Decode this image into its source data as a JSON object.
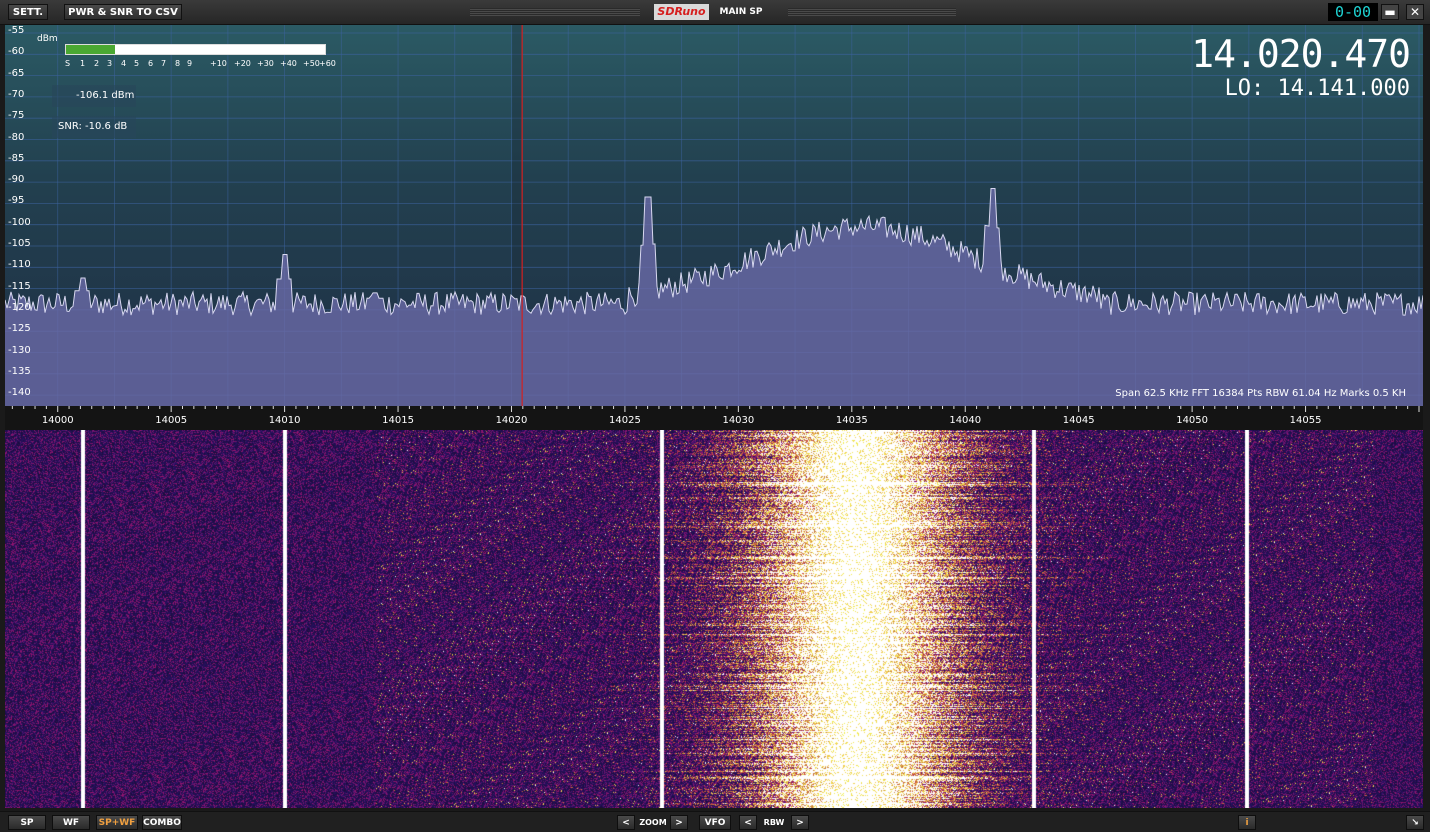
{
  "titlebar": {
    "settings_label": "SETT.",
    "export_label": "PWR & SNR TO CSV",
    "logo_text": "SDRuno",
    "window_name": "MAIN SP",
    "clock": "0-00",
    "minimize": "▬",
    "close": "✕"
  },
  "spectrum": {
    "unit": "dBm",
    "y_labels": [
      "-55",
      "-60",
      "-65",
      "-70",
      "-75",
      "-80",
      "-85",
      "-90",
      "-95",
      "-100",
      "-105",
      "-110",
      "-115",
      "-120",
      "-125",
      "-130",
      "-135",
      "-140"
    ],
    "smeter_labels": [
      "S",
      "1",
      "2",
      "3",
      "4",
      "5",
      "6",
      "7",
      "8",
      "9",
      "+10",
      "+20",
      "+30",
      "+40",
      "+50",
      "+60"
    ],
    "smeter_level": 0.19,
    "power_readout": "-106.1 dBm",
    "snr_readout": "SNR: -10.6 dB",
    "vfo_frequency": "14.020.470",
    "lo_frequency": "LO:  14.141.000",
    "info": "Span 62.5 KHz   FFT 16384 Pts   RBW 61.04 Hz   Marks 0.5 KH",
    "x_labels": [
      "14000",
      "14005",
      "14010",
      "14015",
      "14020",
      "14025",
      "14030",
      "14035",
      "14040",
      "14045",
      "14050",
      "14055"
    ],
    "colors": {
      "trace": "#d8d8f0",
      "fill": "#6a6aa8",
      "marker": "#d42020",
      "grid": "#3d63a0"
    }
  },
  "bottombar": {
    "sp": "SP",
    "wf": "WF",
    "spwf": "SP+WF",
    "combo": "COMBO",
    "zoom_prev": "<",
    "zoom": "ZOOM",
    "zoom_next": ">",
    "vfo": "VFO",
    "rbw_prev": "<",
    "rbw": "RBW",
    "rbw_next": ">",
    "info_icon": "i",
    "resize_icon": "↘"
  }
}
